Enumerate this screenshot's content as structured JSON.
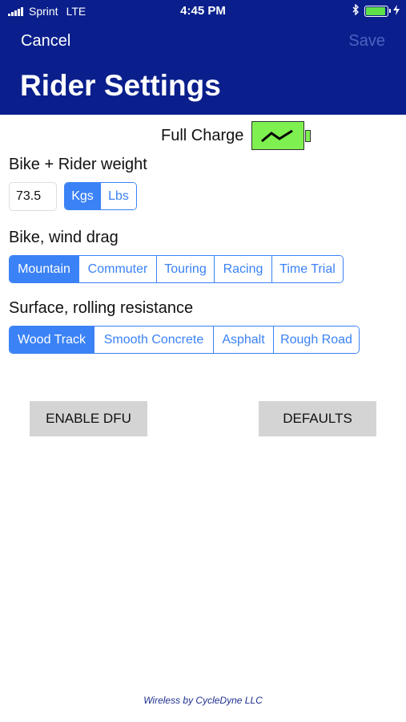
{
  "status_bar": {
    "carrier": "Sprint",
    "network": "LTE",
    "time": "4:45 PM",
    "bluetooth_icon": "bluetooth-icon",
    "battery_level": 0.85,
    "battery_color": "#5ee04a",
    "charging_icon": "bolt-icon"
  },
  "nav": {
    "cancel_label": "Cancel",
    "save_label": "Save",
    "title": "Rider Settings"
  },
  "charge": {
    "label": "Full Charge",
    "battery_color": "#7ef04f"
  },
  "weight": {
    "label": "Bike + Rider weight",
    "value": "73.5",
    "units": [
      {
        "label": "Kgs",
        "selected": true
      },
      {
        "label": "Lbs",
        "selected": false
      }
    ]
  },
  "wind_drag": {
    "label": "Bike, wind drag",
    "options": [
      {
        "label": "Mountain",
        "selected": true
      },
      {
        "label": "Commuter",
        "selected": false
      },
      {
        "label": "Touring",
        "selected": false
      },
      {
        "label": "Racing",
        "selected": false
      },
      {
        "label": "Time Trial",
        "selected": false
      }
    ]
  },
  "surface": {
    "label": "Surface, rolling resistance",
    "options": [
      {
        "label": "Wood Track",
        "selected": true
      },
      {
        "label": "Smooth Concrete",
        "selected": false
      },
      {
        "label": "Asphalt",
        "selected": false
      },
      {
        "label": "Rough Road",
        "selected": false
      }
    ]
  },
  "buttons": {
    "enable_dfu": "ENABLE DFU",
    "defaults": "DEFAULTS"
  },
  "footer": {
    "text": "Wireless by CycleDyne LLC"
  },
  "colors": {
    "header_bg": "#0a1f8c",
    "accent": "#3b82f6",
    "button_gray": "#d4d4d4"
  }
}
